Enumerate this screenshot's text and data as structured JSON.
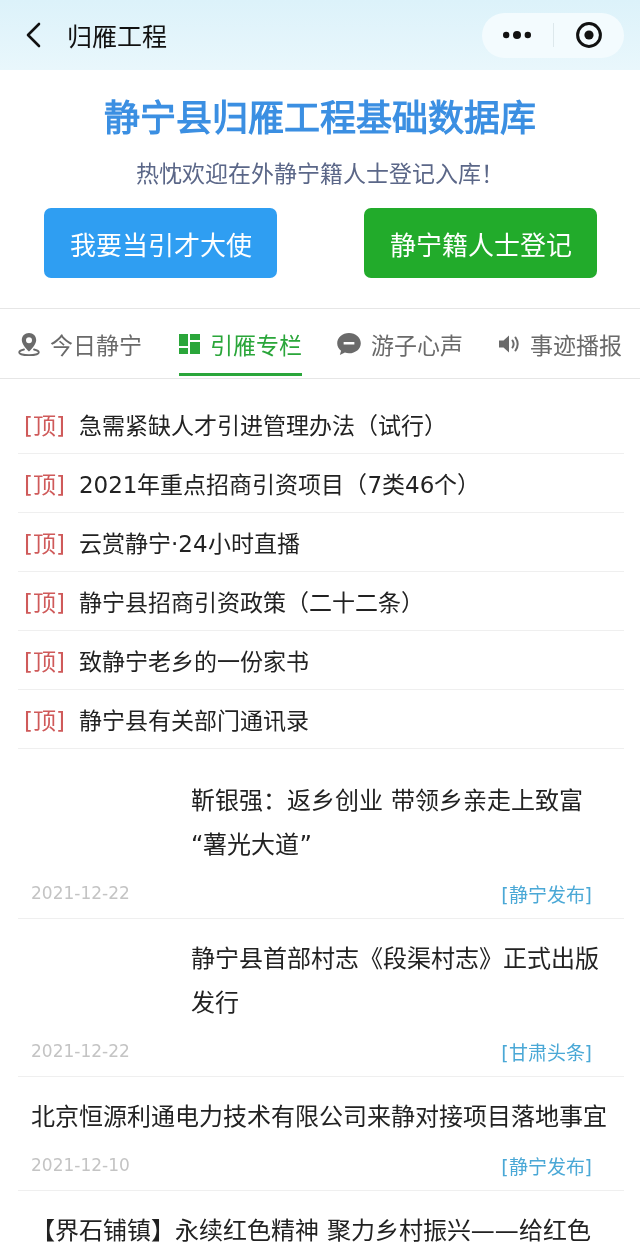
{
  "nav_bar": {
    "title": "归雁工程"
  },
  "hero": {
    "title": "静宁县归雁工程基础数据库",
    "subtitle": "热忱欢迎在外静宁籍人士登记入库！",
    "buttons": [
      {
        "label": "我要当引才大使",
        "color": "#2f9ef2"
      },
      {
        "label": "静宁籍人士登记",
        "color": "#22ab2b"
      }
    ]
  },
  "tabs": [
    {
      "label": "今日静宁",
      "selected": false
    },
    {
      "label": "引雁专栏",
      "selected": true
    },
    {
      "label": "游子心声",
      "selected": false
    },
    {
      "label": "事迹播报",
      "selected": false
    }
  ],
  "pinned": [
    {
      "tag": "[顶]",
      "title": "急需紧缺人才引进管理办法（试行）"
    },
    {
      "tag": "[顶]",
      "title": "2021年重点招商引资项目（7类46个）"
    },
    {
      "tag": "[顶]",
      "title": "云赏静宁·24小时直播"
    },
    {
      "tag": "[顶]",
      "title": "静宁县招商引资政策（二十二条）"
    },
    {
      "tag": "[顶]",
      "title": "致静宁老乡的一份家书"
    },
    {
      "tag": "[顶]",
      "title": "静宁县有关部门通讯录"
    }
  ],
  "news": [
    {
      "kind": "inset",
      "title": "靳银强：返乡创业 带领乡亲走上致富“薯光大道”",
      "date": "2021-12-22",
      "source": "[静宁发布]"
    },
    {
      "kind": "inset",
      "title": "静宁县首部村志《段渠村志》正式出版发行",
      "date": "2021-12-22",
      "source": "[甘肃头条]"
    },
    {
      "kind": "plain",
      "title": "北京恒源利通电力技术有限公司来静对接项目落地事宜",
      "date": "2021-12-10",
      "source": "[静宁发布]"
    },
    {
      "kind": "plain",
      "title": "【界石铺镇】永续红色精神 聚力乡村振兴——给红色"
    }
  ]
}
